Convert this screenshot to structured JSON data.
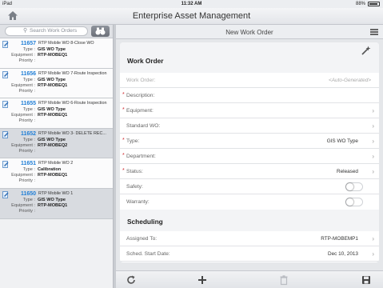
{
  "status_bar": {
    "device": "iPad",
    "time": "11:32 AM",
    "battery": "88%"
  },
  "nav": {
    "title": "Enterprise Asset Management",
    "home_icon": "home-icon"
  },
  "search": {
    "placeholder": "Search Work Orders"
  },
  "work_orders": [
    {
      "number": "11657",
      "description": "RTP Mobile WO 8-Close WO",
      "type_label": "Type :",
      "type": "GIS WO Type",
      "equipment_label": "Equipment :",
      "equipment": "RTP-MOBEQ1",
      "priority_label": "Priority :",
      "priority": ""
    },
    {
      "number": "11656",
      "description": "RTP Mobile WO 7-Route Inspection",
      "type_label": "Type :",
      "type": "GIS WO Type",
      "equipment_label": "Equipment :",
      "equipment": "RTP-MOBEQ1",
      "priority_label": "Priority :",
      "priority": ""
    },
    {
      "number": "11655",
      "description": "RTP Mobile WO 6-Route Inspection",
      "type_label": "Type :",
      "type": "GIS WO Type",
      "equipment_label": "Equipment :",
      "equipment": "RTP-MOBEQ1",
      "priority_label": "Priority :",
      "priority": ""
    },
    {
      "number": "11652",
      "description": "RTP Mobile WO 3- DELETE REC...",
      "type_label": "Type :",
      "type": "GIS WO Type",
      "equipment_label": "Equipment :",
      "equipment": "RTP-MOBEQ2",
      "priority_label": "Priority :",
      "priority": ""
    },
    {
      "number": "11651",
      "description": "RTP Mobile WO 2",
      "type_label": "Type :",
      "type": "Calibration",
      "equipment_label": "Equipment :",
      "equipment": "RTP-MOBEQ1",
      "priority_label": "Priority :",
      "priority": ""
    },
    {
      "number": "11650",
      "description": "RTP Mobile WO 1",
      "type_label": "Type :",
      "type": "GIS WO Type",
      "equipment_label": "Equipment :",
      "equipment": "RTP-MOBEQ1",
      "priority_label": "Priority :",
      "priority": ""
    }
  ],
  "form": {
    "header_title": "New Work Order",
    "section_work_order": "Work Order",
    "section_scheduling": "Scheduling",
    "fields": {
      "work_order": {
        "label": "Work Order:",
        "value": "<Auto-Generated>"
      },
      "description": {
        "label": "Description:",
        "value": ""
      },
      "equipment": {
        "label": "Equipment:",
        "value": ""
      },
      "standard_wo": {
        "label": "Standard WO:",
        "value": ""
      },
      "type": {
        "label": "Type:",
        "value": "GIS WO Type"
      },
      "department": {
        "label": "Department:",
        "value": ""
      },
      "status": {
        "label": "Status:",
        "value": "Released"
      },
      "safety": {
        "label": "Safety:",
        "value": "off"
      },
      "warranty": {
        "label": "Warranty:",
        "value": "off"
      },
      "assigned_to": {
        "label": "Assigned To:",
        "value": "RTP-MOBEMP1"
      },
      "sched_start": {
        "label": "Sched. Start Date:",
        "value": "Dec 10, 2013"
      }
    },
    "required_marker": "*"
  },
  "toolbar": {
    "icons": [
      "refresh-icon",
      "add-icon",
      "trash-icon",
      "save-icon"
    ]
  },
  "colors": {
    "accent": "#1f7ed6",
    "required": "#d0262b"
  }
}
